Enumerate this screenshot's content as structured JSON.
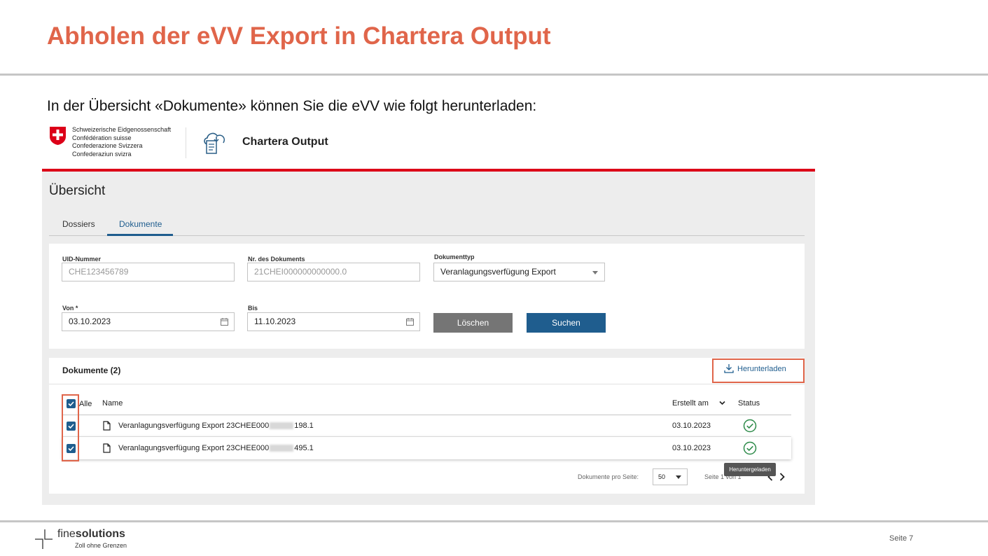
{
  "slide": {
    "title": "Abholen der eVV Export in Chartera Output",
    "intro": "In der Übersicht «Dokumente» können Sie die eVV wie folgt herunterladen:"
  },
  "app": {
    "gov_lines": [
      "Schweizerische Eidgenossenschaft",
      "Confédération suisse",
      "Confederazione Svizzera",
      "Confederaziun svizra"
    ],
    "name": "Chartera Output",
    "brand_red": "#dc0018"
  },
  "overview": {
    "heading": "Übersicht",
    "tabs": [
      {
        "label": "Dossiers",
        "active": false
      },
      {
        "label": "Dokumente",
        "active": true
      }
    ]
  },
  "filters": {
    "uid": {
      "label": "UID-Nummer",
      "placeholder": "CHE123456789"
    },
    "doc_nr": {
      "label": "Nr. des Dokuments",
      "placeholder": "21CHEI000000000000.0"
    },
    "doc_type": {
      "label": "Dokumenttyp",
      "value": "Veranlagungsverfügung Export"
    },
    "von": {
      "label": "Von *",
      "value": "03.10.2023"
    },
    "bis": {
      "label": "Bis",
      "value": "11.10.2023"
    },
    "clear_label": "Löschen",
    "search_label": "Suchen"
  },
  "documents": {
    "title": "Dokumente (2)",
    "download_label": "Herunterladen",
    "columns": {
      "all": "Alle",
      "name": "Name",
      "created": "Erstellt am",
      "status": "Status"
    },
    "rows": [
      {
        "name_prefix": "Veranlagungsverfügung Export 23CHEE000",
        "name_suffix": "198.1",
        "created": "03.10.2023",
        "checked": true
      },
      {
        "name_prefix": "Veranlagungsverfügung Export 23CHEE000",
        "name_suffix": "495.1",
        "created": "03.10.2023",
        "checked": true
      }
    ],
    "tooltip": "Heruntergeladen",
    "per_page_label": "Dokumente pro Seite:",
    "per_page_value": "50",
    "page_info": "Seite 1 von 1",
    "accent": "#1f5d8e",
    "highlight": "#e0654a"
  },
  "footer": {
    "logo_regular": "fine",
    "logo_bold": "solutions",
    "tagline": "Zoll ohne Grenzen",
    "page_label": "Seite  7"
  }
}
